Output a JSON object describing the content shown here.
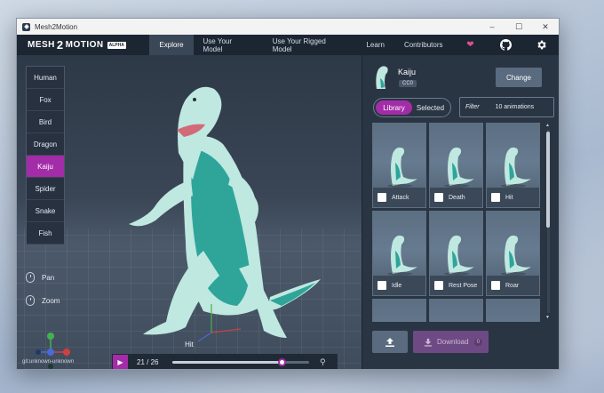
{
  "window": {
    "title": "Mesh2Motion"
  },
  "window_controls": [
    "–",
    "☐",
    "✕"
  ],
  "logo": {
    "part1": "MESH",
    "part2": "2",
    "part3": "MOTION",
    "badge": "ALPHA"
  },
  "nav": {
    "items": [
      {
        "label": "Explore",
        "active": true
      },
      {
        "label": "Use Your Model",
        "active": false
      },
      {
        "label": "Use Your Rigged Model",
        "active": false
      },
      {
        "label": "Learn",
        "active": false
      },
      {
        "label": "Contributors",
        "active": false
      }
    ],
    "icons": [
      "heart-icon",
      "github-icon",
      "gear-icon"
    ]
  },
  "models": [
    "Human",
    "Fox",
    "Bird",
    "Dragon",
    "Kaiju",
    "Spider",
    "Snake",
    "Fish"
  ],
  "active_model": "Kaiju",
  "tools": {
    "pan": "Pan",
    "zoom": "Zoom"
  },
  "git_info": "git:unknown-unknown",
  "player": {
    "animation_name": "Hit",
    "current_frame": "21",
    "separator": "/",
    "total_frames": "26",
    "progress": 0.8
  },
  "panel": {
    "model_name": "Kaiju",
    "license": "CC0",
    "change_label": "Change",
    "toggle": {
      "library": "Library",
      "selected": "Selected"
    },
    "filter_label": "Filter",
    "animation_count": "10 animations",
    "animations": [
      "Attack",
      "Death",
      "Hit",
      "Idle",
      "Rest Pose",
      "Roar",
      "",
      "",
      ""
    ],
    "download_label": "Download",
    "download_count": "0"
  },
  "colors": {
    "accent": "#a32ca8",
    "kaiju_body": "#bfe8e0",
    "kaiju_belly": "#2fa59a"
  }
}
